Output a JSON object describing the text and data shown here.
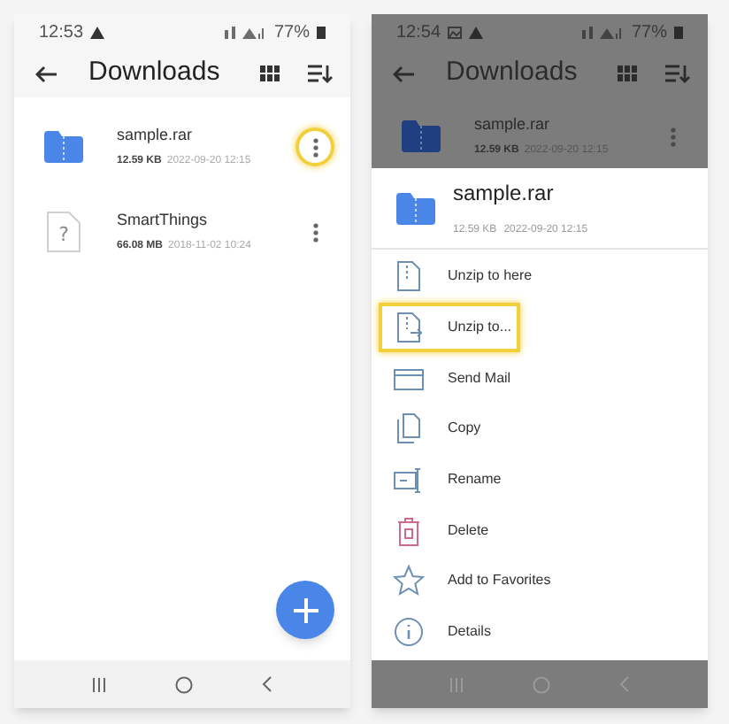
{
  "screens": [
    {
      "kind": "file-list",
      "status_bar": {
        "time": "12:53",
        "battery": "77%"
      },
      "app_bar": {
        "title": "Downloads"
      },
      "files": [
        {
          "kind": "archive",
          "name": "sample.rar",
          "size": "12.59 KB",
          "date": "2022-09-20 12:15",
          "highlighted": true
        },
        {
          "kind": "unknown",
          "icon_glyph": "?",
          "name": "SmartThings",
          "size": "66.08 MB",
          "date": "2018-11-02 10:24",
          "highlighted": false
        }
      ]
    },
    {
      "kind": "context-menu",
      "status_bar": {
        "time": "12:54",
        "battery": "77%"
      },
      "app_bar": {
        "title": "Downloads"
      },
      "files": [
        {
          "kind": "archive",
          "name": "sample.rar",
          "size": "12.59 KB",
          "date": "2022-09-20 12:15",
          "highlighted": false
        }
      ],
      "sheet": {
        "name": "sample.rar",
        "size": "12.59 KB",
        "date": "2022-09-20 12:15"
      },
      "menu_items": [
        {
          "kind": "unzip-here",
          "label": "Unzip to here",
          "highlighted": false
        },
        {
          "kind": "unzip-to",
          "label": "Unzip to...",
          "highlighted": true
        },
        {
          "kind": "mail",
          "label": "Send Mail",
          "highlighted": false
        },
        {
          "kind": "copy",
          "label": "Copy",
          "highlighted": false
        },
        {
          "kind": "rename",
          "label": "Rename",
          "highlighted": false
        },
        {
          "kind": "delete",
          "label": "Delete",
          "highlighted": false
        },
        {
          "kind": "favorite",
          "label": "Add to Favorites",
          "highlighted": false
        },
        {
          "kind": "details",
          "label": "Details",
          "highlighted": false
        }
      ]
    }
  ]
}
